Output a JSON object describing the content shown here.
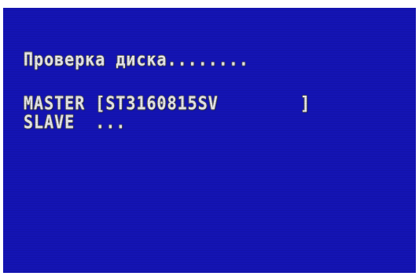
{
  "screen": {
    "title": "Проверка диска........",
    "master_line": "MASTER [ST3160815SV        ]",
    "slave_line": "SLAVE  ...",
    "background_color": "#1414b4",
    "text_color": "#e4e4ec"
  }
}
